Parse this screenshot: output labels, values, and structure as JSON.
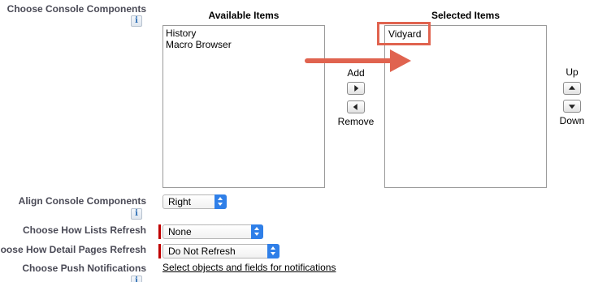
{
  "console_components": {
    "label": "Choose Console Components",
    "info_icon": "info-icon",
    "available_heading": "Available Items",
    "selected_heading": "Selected Items",
    "available_items": [
      "History",
      "Macro Browser"
    ],
    "selected_items": [
      "Vidyard"
    ],
    "add_label": "Add",
    "remove_label": "Remove",
    "up_label": "Up",
    "down_label": "Down"
  },
  "align": {
    "label": "Align Console Components",
    "value": "Right"
  },
  "lists_refresh": {
    "label": "Choose How Lists Refresh",
    "value": "None"
  },
  "detail_refresh": {
    "label": "Choose How Detail Pages Refresh",
    "value": "Do Not Refresh"
  },
  "push_notifications": {
    "label": "Choose Push Notifications",
    "link_text": "Select objects and fields for notifications"
  },
  "colors": {
    "annotation": "#e0634f",
    "required": "#c00000",
    "select_toggle": "#2f7fe8",
    "label_text": "#4a4a56"
  }
}
